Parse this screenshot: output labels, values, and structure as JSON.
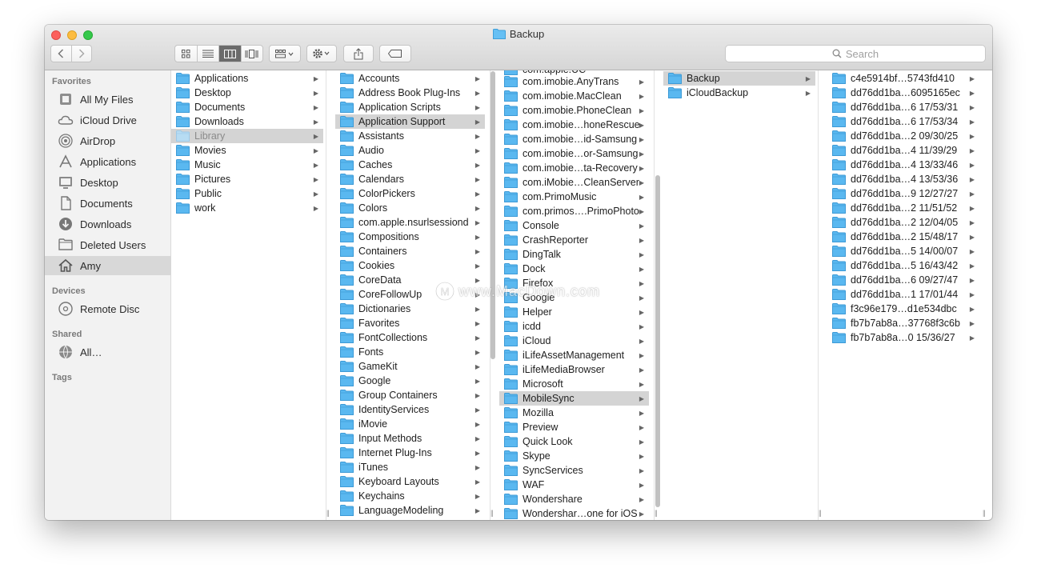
{
  "window": {
    "title": "Backup"
  },
  "toolbar": {
    "search_placeholder": "Search"
  },
  "sidebar": {
    "sections": {
      "favorites": "Favorites",
      "devices": "Devices",
      "shared": "Shared",
      "tags": "Tags"
    },
    "favorites": [
      {
        "label": "All My Files",
        "icon": "all-files-icon"
      },
      {
        "label": "iCloud Drive",
        "icon": "cloud-icon"
      },
      {
        "label": "AirDrop",
        "icon": "airdrop-icon"
      },
      {
        "label": "Applications",
        "icon": "applications-icon"
      },
      {
        "label": "Desktop",
        "icon": "desktop-icon"
      },
      {
        "label": "Documents",
        "icon": "documents-icon"
      },
      {
        "label": "Downloads",
        "icon": "downloads-icon"
      },
      {
        "label": "Deleted Users",
        "icon": "folder-icon"
      },
      {
        "label": "Amy",
        "icon": "home-icon",
        "selected": true
      }
    ],
    "devices": [
      {
        "label": "Remote Disc",
        "icon": "disc-icon"
      }
    ],
    "shared": [
      {
        "label": "All…",
        "icon": "network-icon"
      }
    ]
  },
  "columns": [
    {
      "items": [
        "Applications",
        "Desktop",
        "Documents",
        "Downloads",
        "Library",
        "Movies",
        "Music",
        "Pictures",
        "Public",
        "work"
      ],
      "selected": 4,
      "dim": 4,
      "chevrons": [
        0,
        1,
        2,
        3,
        4
      ]
    },
    {
      "items": [
        "Accounts",
        "Address Book Plug-Ins",
        "Application Scripts",
        "Application Support",
        "Assistants",
        "Audio",
        "Caches",
        "Calendars",
        "ColorPickers",
        "Colors",
        "com.apple.nsurlsessiond",
        "Compositions",
        "Containers",
        "Cookies",
        "CoreData",
        "CoreFollowUp",
        "Dictionaries",
        "Favorites",
        "FontCollections",
        "Fonts",
        "GameKit",
        "Google",
        "Group Containers",
        "IdentityServices",
        "iMovie",
        "Input Methods",
        "Internet Plug-Ins",
        "iTunes",
        "Keyboard Layouts",
        "Keychains",
        "LanguageModeling"
      ],
      "selected": 3
    },
    {
      "top_partial": "com.apple.UC",
      "items": [
        "com.imobie.AnyTrans",
        "com.imobie.MacClean",
        "com.imobie.PhoneClean",
        "com.imobie…honeRescue",
        "com.imobie…id-Samsung",
        "com.imobie…or-Samsung",
        "com.imobie…ta-Recovery",
        "com.iMobie…CleanServer",
        "com.PrimoMusic",
        "com.primos….PrimoPhoto",
        "Console",
        "CrashReporter",
        "DingTalk",
        "Dock",
        "Firefox",
        "Google",
        "Helper",
        "icdd",
        "iCloud",
        "iLifeAssetManagement",
        "iLifeMediaBrowser",
        "Microsoft",
        "MobileSync",
        "Mozilla",
        "Preview",
        "Quick Look",
        "Skype",
        "SyncServices",
        "WAF",
        "Wondershare",
        "Wondershar…one for iOS"
      ],
      "selected": 22
    },
    {
      "items": [
        "Backup",
        "iCloudBackup"
      ],
      "selected": 0
    },
    {
      "items": [
        "c4e5914bf…5743fd410",
        "dd76dd1ba…6095165ec",
        "dd76dd1ba…6 17/53/31",
        "dd76dd1ba…6 17/53/34",
        "dd76dd1ba…2 09/30/25",
        "dd76dd1ba…4 11/39/29",
        "dd76dd1ba…4 13/33/46",
        "dd76dd1ba…4 13/53/36",
        "dd76dd1ba…9 12/27/27",
        "dd76dd1ba…2 11/51/52",
        "dd76dd1ba…2 12/04/05",
        "dd76dd1ba…2 15/48/17",
        "dd76dd1ba…5 14/00/07",
        "dd76dd1ba…5 16/43/42",
        "dd76dd1ba…6 09/27/47",
        "dd76dd1ba…1 17/01/44",
        "f3c96e179…d1e534dbc",
        "fb7b7ab8a…37768f3c6b",
        "fb7b7ab8a…0 15/36/27"
      ],
      "selected": -1
    }
  ],
  "watermark": "www.MacDown.com",
  "colors": {
    "folder": "#5ab8f0",
    "selection": "#d4d4d4",
    "sidebar": "#f2f2f2"
  }
}
